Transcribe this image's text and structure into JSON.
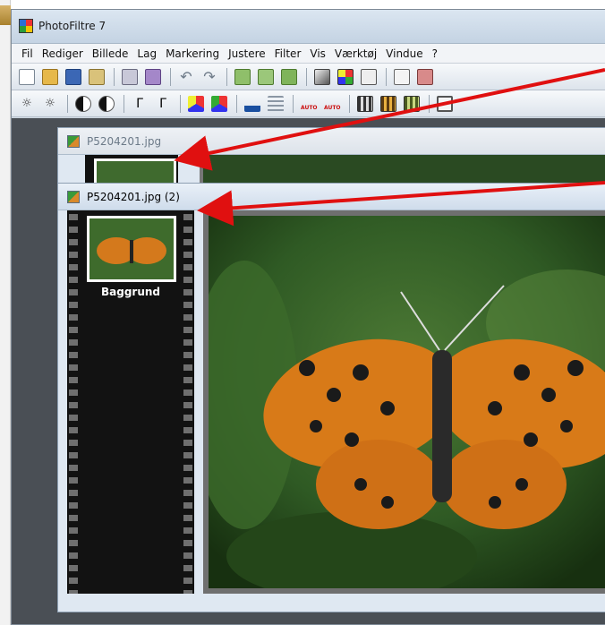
{
  "app": {
    "title": "PhotoFiltre 7"
  },
  "menu": {
    "items": [
      "Fil",
      "Rediger",
      "Billede",
      "Lag",
      "Markering",
      "Justere",
      "Filter",
      "Vis",
      "Værktøj",
      "Vindue",
      "?"
    ]
  },
  "toolbar1": {
    "buttons": [
      "new-icon",
      "open-icon",
      "save-icon",
      "paste-icon",
      "print-icon",
      "scan-icon",
      "undo-icon",
      "redo-icon",
      "image-size-icon",
      "canvas-size-icon",
      "crop-icon",
      "gray-icon",
      "palette-icon",
      "levels-icon",
      "copy-icon",
      "more-icon"
    ]
  },
  "toolbar2": {
    "buttons": [
      "brightness-minus-icon",
      "brightness-plus-icon",
      "contrast-minus-icon",
      "contrast-plus-icon",
      "gamma-minus-icon",
      "gamma-plus-icon",
      "saturation-minus-icon",
      "saturation-plus-icon",
      "sharpen-icon",
      "blur-icon",
      "auto-levels-icon",
      "auto-contrast-icon",
      "grid1-icon",
      "grid2-icon",
      "grid3-icon",
      "frame-icon"
    ],
    "auto_labels": [
      "AUTO",
      "AUTO"
    ]
  },
  "documents": {
    "back": {
      "title": "P5204201.jpg"
    },
    "front": {
      "title": "P5204201.jpg (2)"
    }
  },
  "layers": {
    "items": [
      {
        "label": "Baggrund"
      }
    ]
  },
  "colors": {
    "annotation_arrow": "#e01010",
    "workspace": "#4a4f55",
    "filmstrip": "#121212"
  }
}
